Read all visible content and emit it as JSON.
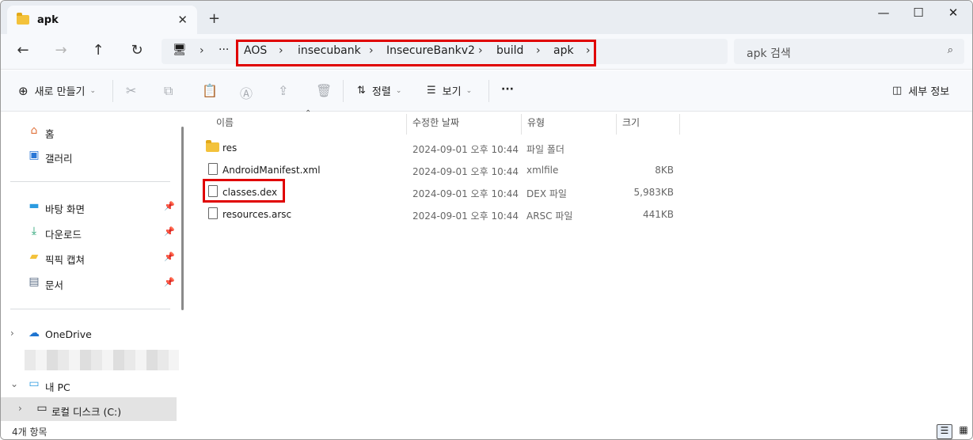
{
  "tab": {
    "title": "apk",
    "close": "✕",
    "new": "+"
  },
  "window": {
    "min": "—",
    "max": "☐",
    "close": "✕"
  },
  "nav": {
    "back": "←",
    "forward": "→",
    "up": "↑",
    "refresh": "↻"
  },
  "address": {
    "more": "···",
    "crumbs": [
      "AOS",
      "insecubank",
      "InsecureBankv2",
      "build",
      "apk"
    ]
  },
  "search": {
    "placeholder": "apk 검색"
  },
  "toolbar": {
    "new_label": "새로 만들기",
    "sort_label": "정렬",
    "view_label": "보기",
    "more": "···",
    "details_label": "세부 정보"
  },
  "sidebar": {
    "quick": [
      {
        "label": "홈"
      },
      {
        "label": "갤러리"
      }
    ],
    "pinned": [
      {
        "label": "바탕 화면"
      },
      {
        "label": "다운로드"
      },
      {
        "label": "픽픽 캡쳐"
      },
      {
        "label": "문서"
      }
    ],
    "onedrive": "OneDrive",
    "thispc": "내 PC",
    "local_disk": "로컬 디스크 (C:)"
  },
  "columns": {
    "name": "이름",
    "modified": "수정한 날짜",
    "type": "유형",
    "size": "크기"
  },
  "files": [
    {
      "name": "res",
      "modified": "2024-09-01 오후 10:44",
      "type": "파일 폴더",
      "size": ""
    },
    {
      "name": "AndroidManifest.xml",
      "modified": "2024-09-01 오후 10:44",
      "type": "xmlfile",
      "size": "8KB"
    },
    {
      "name": "classes.dex",
      "modified": "2024-09-01 오후 10:44",
      "type": "DEX 파일",
      "size": "5,983KB"
    },
    {
      "name": "resources.arsc",
      "modified": "2024-09-01 오후 10:44",
      "type": "ARSC 파일",
      "size": "441KB"
    }
  ],
  "status": {
    "count": "4개 항목"
  }
}
